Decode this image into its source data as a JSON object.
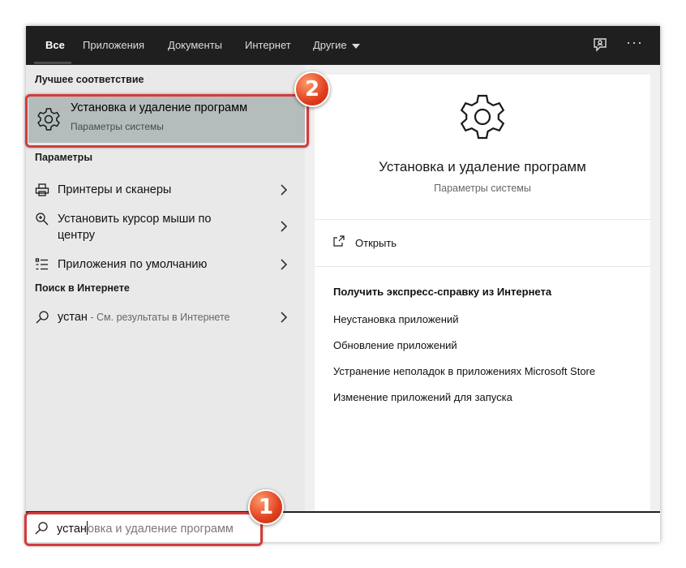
{
  "tabs": [
    {
      "label": "Все"
    },
    {
      "label": "Приложения"
    },
    {
      "label": "Документы"
    },
    {
      "label": "Интернет"
    },
    {
      "label": "Другие"
    }
  ],
  "topbar_icons": [
    "feedback-icon",
    "more-icon"
  ],
  "more_label": "···",
  "left": {
    "best_match_heading": "Лучшее соответствие",
    "best_match": {
      "title": "Установка и удаление программ",
      "subtitle": "Параметры системы",
      "icon": "gear-icon"
    },
    "settings_heading": "Параметры",
    "settings_items": [
      {
        "label": "Принтеры и сканеры",
        "icon": "printer-icon"
      },
      {
        "label": "Установить курсор мыши по",
        "label2": "центру",
        "icon": "magnifier-icon"
      },
      {
        "label": "Приложения по умолчанию",
        "icon": "list-icon"
      }
    ],
    "web_heading": "Поиск в Интернете",
    "web_item": {
      "query": "устан",
      "hint": " - См. результаты в Интернете",
      "icon": "search-icon"
    }
  },
  "right": {
    "app_title": "Установка и удаление программ",
    "app_subtitle": "Параметры системы",
    "open_label": "Открыть",
    "help_heading": "Получить экспресс-справку из Интернета",
    "help_links": [
      "Неустановка приложений",
      "Обновление приложений",
      "Устранение неполадок в приложениях Microsoft Store",
      "Изменение приложений для запуска"
    ]
  },
  "search": {
    "typed": "устан",
    "suggestion": "овка и удаление программ"
  },
  "badges": [
    "1",
    "2"
  ],
  "colors": {
    "topbar": "#1f1f1f",
    "left_pane": "#e9e9e9",
    "selected": "#b5bcbc",
    "highlight": "#d43b3b",
    "badge": "#e0401f"
  }
}
